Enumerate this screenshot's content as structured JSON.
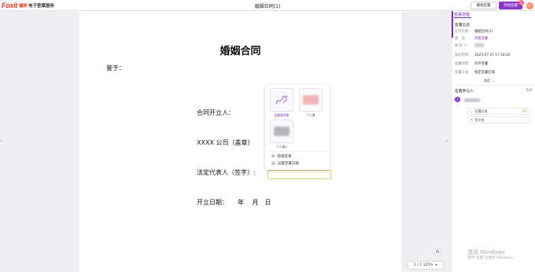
{
  "header": {
    "logo_foxit": "Foxit",
    "logo_cn": "福昕",
    "product": "电子签章服务",
    "title": "婚姻合同",
    "title_suffix": "(1)",
    "cancel_label": "撤销签署",
    "start_label": "开始签署",
    "start_badge": "3",
    "avatar_letter": "C"
  },
  "document": {
    "title": "婚姻合同",
    "line_signed": "鉴于：",
    "line_issuer": "合同开立人：",
    "line_company": "XXXX 公司（盖章）",
    "line_rep": "法定代表人（签字）:",
    "line_date": "开立日期：　　年　 月　日"
  },
  "popup": {
    "create_label": "创建临时章",
    "personal_label": "个人章",
    "personal2_label": "个人章2",
    "manage_label": "管理签章",
    "date_label": "设置签署日期"
  },
  "panel": {
    "tab": "签署流程",
    "section_info": "签署信息",
    "fields": [
      {
        "k": "任务名称：",
        "v": "婚姻合同(1)"
      },
      {
        "k": "状　态：",
        "v": "待我签署"
      },
      {
        "k": "发 起 人：",
        "v": ""
      },
      {
        "k": "发起时间：",
        "v": "2025-07-25 17:34:26"
      },
      {
        "k": "签署场景：",
        "v": "对外签署"
      },
      {
        "k": "签署方式：",
        "v": "指定签署区域"
      }
    ],
    "collapse": "收起",
    "participants": "签署参与人",
    "order": "有序",
    "signer_index": "1",
    "rows": [
      {
        "label": "签署区域",
        "count": "0/1"
      },
      {
        "label": "签名框",
        "count": ""
      }
    ]
  },
  "viewer": {
    "zoom": "1 / 1  125%"
  },
  "watermark": {
    "line1": "激活 Windows",
    "line2": "转到\"设置\"以激活 Windows。"
  },
  "colors": {
    "accent": "#8a35c9",
    "brand": "#e2391b"
  }
}
